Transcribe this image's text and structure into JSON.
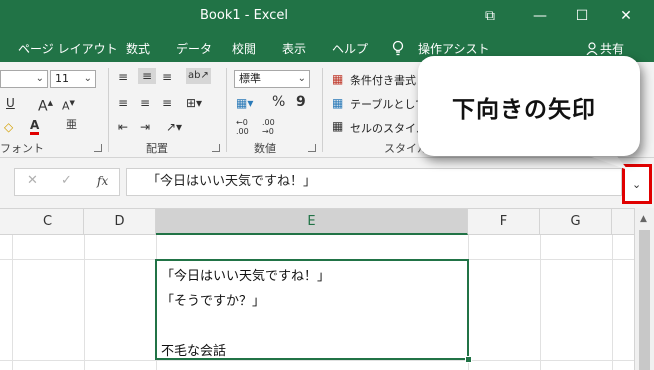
{
  "window": {
    "title": "Book1  -  Excel",
    "minimize_glyph": "—",
    "restore_glyph": "☐",
    "close_glyph": "✕",
    "ribbon_display_glyph": "⧉"
  },
  "tabs": [
    "ページ レイアウト",
    "数式",
    "データ",
    "校閲",
    "表示",
    "ヘルプ",
    "操作アシスト"
  ],
  "tell_me_icon": "lightbulb-icon",
  "share": {
    "label": "共有",
    "icon": "person-icon"
  },
  "ribbon": {
    "font_size": "11",
    "number_format": "標準",
    "buttons": {
      "conditional_format": "条件付き書式",
      "format_as_table": "テーブルとして書",
      "cell_styles": "セルのスタイル",
      "percent": "%",
      "comma": "9",
      "increase_decimal": "←0 .00",
      "decrease_decimal": ".00 →0"
    },
    "groups": {
      "font": "フォント",
      "alignment": "配置",
      "number": "数値",
      "styles": "スタイル"
    }
  },
  "formula_bar": {
    "cancel_glyph": "✕",
    "enter_glyph": "✓",
    "fx_label": "fx",
    "value": "「今日はいい天気ですね！」"
  },
  "columns": [
    "C",
    "D",
    "E",
    "F",
    "G"
  ],
  "active_column": "E",
  "cell": {
    "lines": [
      "「今日はいい天気ですね！」",
      "「そうですか？」",
      "",
      "不毛な会話"
    ]
  },
  "callout": {
    "text": "下向きの矢印"
  },
  "colors": {
    "excel_green": "#217346",
    "highlight_red": "#e00000"
  }
}
